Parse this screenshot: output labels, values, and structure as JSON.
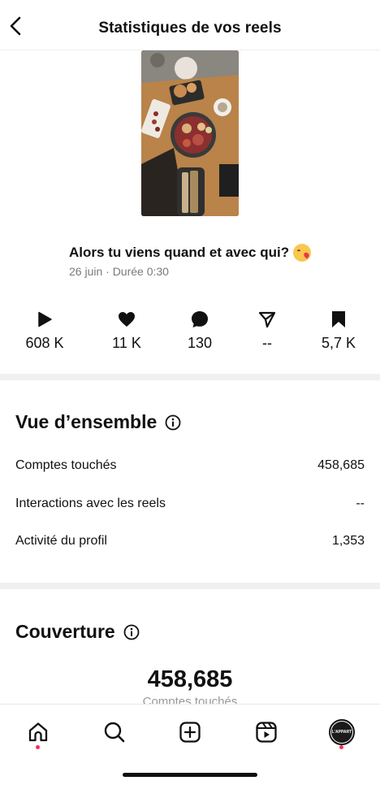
{
  "header": {
    "title": "Statistiques de vos reels"
  },
  "reel": {
    "title": "Alors tu viens quand et avec qui?",
    "meta": "26 juin · Durée 0:30"
  },
  "stats": {
    "plays": "608 K",
    "likes": "11 K",
    "comments": "130",
    "shares": "--",
    "saves": "5,7 K"
  },
  "overview": {
    "title": "Vue d’ensemble",
    "rows": [
      {
        "label": "Comptes touchés",
        "value": "458,685"
      },
      {
        "label": "Interactions avec les reels",
        "value": "--"
      },
      {
        "label": "Activité du profil",
        "value": "1,353"
      }
    ]
  },
  "coverage": {
    "title": "Couverture",
    "number": "458,685",
    "label": "Comptes touchés"
  },
  "nav": {
    "avatar_text": "L'APPART"
  },
  "icons": {
    "back": "chevron-left-icon",
    "plays": "play-icon",
    "likes": "heart-icon",
    "comments": "comment-icon",
    "shares": "send-icon",
    "saves": "bookmark-icon",
    "info": "info-icon",
    "home": "home-icon",
    "search": "search-icon",
    "create": "add-square-icon",
    "reels": "reels-icon"
  },
  "colors": {
    "notification_dot": "#ff2d55",
    "secondary_text": "#7a7a7a"
  }
}
